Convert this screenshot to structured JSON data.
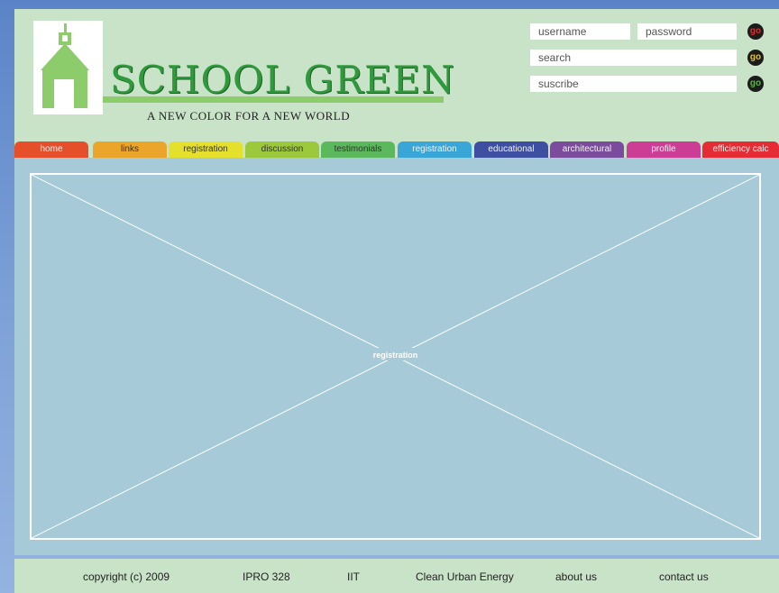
{
  "header": {
    "logo_title": "SCHOOL GREEN",
    "tagline": "A NEW COLOR FOR A NEW WORLD"
  },
  "login": {
    "username_placeholder": "username",
    "password_placeholder": "password",
    "search_placeholder": "search",
    "subscribe_placeholder": "suscribe",
    "go_label": "go",
    "go_colors": [
      "#d9322b",
      "#e8c31f",
      "#5db14a"
    ]
  },
  "nav": {
    "tabs": [
      {
        "label": "home",
        "color": "#e5502a"
      },
      {
        "label": "links",
        "color": "#eaa52a"
      },
      {
        "label": "registration",
        "color": "#e4e02b"
      },
      {
        "label": "discussion",
        "color": "#9cc93c"
      },
      {
        "label": "testimonials",
        "color": "#5cb85c"
      },
      {
        "label": "registration",
        "color": "#3aa6d8"
      },
      {
        "label": "educational",
        "color": "#3e4fa2"
      },
      {
        "label": "architectural",
        "color": "#7c4c9c"
      },
      {
        "label": "profile",
        "color": "#cc3d95"
      },
      {
        "label": "efficiency calc",
        "color": "#e52b34"
      }
    ]
  },
  "content": {
    "placeholder_label": "registration"
  },
  "footer": {
    "links": [
      "copyright (c) 2009",
      "IPRO 328",
      "IIT",
      "Clean Urban Energy",
      "about us",
      "contact us"
    ]
  },
  "colors": {
    "brand_green": "#2f9a3c",
    "panel_green": "#c8e3c8",
    "content_blue": "#a6cad8"
  }
}
